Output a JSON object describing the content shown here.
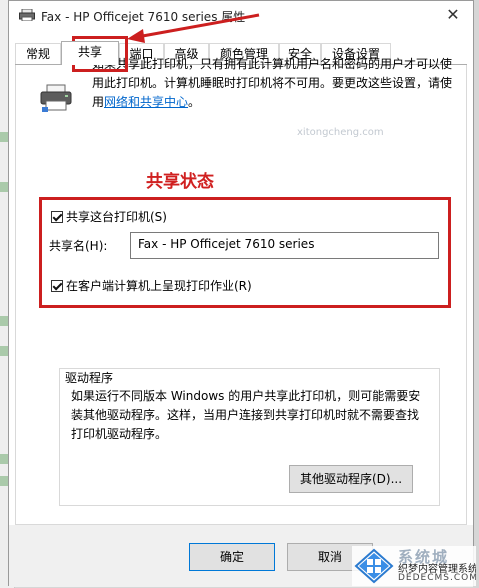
{
  "window": {
    "title": "Fax - HP Officejet 7610 series 属性",
    "close_glyph": "✕"
  },
  "tabs": [
    {
      "label": "常规"
    },
    {
      "label": "共享",
      "active": true
    },
    {
      "label": "端口"
    },
    {
      "label": "高级"
    },
    {
      "label": "颜色管理"
    },
    {
      "label": "安全"
    },
    {
      "label": "设备设置"
    }
  ],
  "info": {
    "line1": "如果共享此打印机，只有拥有此计算机用户名和密码的用户才可以使",
    "line2": "用此打印机。计算机睡眠时打印机将不可用。要更改这些设置，请使",
    "line3_prefix": "用",
    "link": "网络和共享中心",
    "line3_suffix": "。"
  },
  "annotation": {
    "text": "共享状态",
    "color": "#d02020"
  },
  "share": {
    "share_checkbox_label": "共享这台打印机(S)",
    "share_checked": true,
    "share_name_label": "共享名(H):",
    "share_name_value": "Fax - HP Officejet 7610 series",
    "render_checkbox_label": "在客户端计算机上呈现打印作业(R)",
    "render_checked": true
  },
  "drivers": {
    "legend": "驱动程序",
    "line1": "如果运行不同版本 Windows 的用户共享此打印机，则可能需要安",
    "line2": "装其他驱动程序。这样，当用户连接到共享打印机时就不需要查找",
    "line3": "打印机驱动程序。",
    "button": "其他驱动程序(D)..."
  },
  "footer": {
    "ok": "确定",
    "cancel": "取消"
  },
  "watermarks": {
    "faint": "xitongcheng.com",
    "brand_top": "系统城",
    "brand_cn": "织梦内容管理系统",
    "brand_en": "DEDECMS.COM"
  },
  "colors": {
    "highlight": "#cc1f1f",
    "link": "#0066cc",
    "primary_button_border": "#0078d7"
  }
}
